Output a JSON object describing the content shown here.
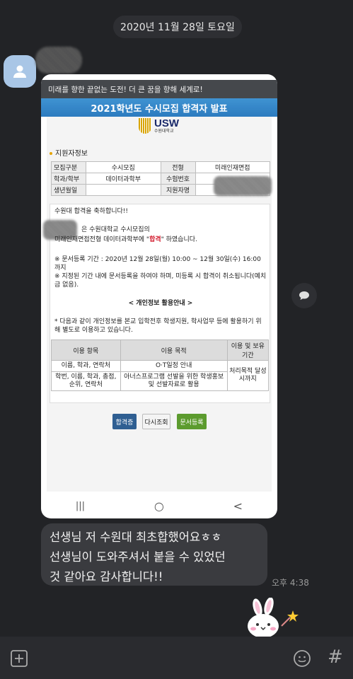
{
  "date_divider": "2020년 11월 28일 토요일",
  "colors": {
    "background": "#222326",
    "bubble": "#3a3b3f",
    "avatar": "#a9c6e6",
    "title_bar": "#2c7bbf",
    "accent_red": "#d2192b"
  },
  "icons": {
    "avatar": "person-icon",
    "share": "speech-bubble-icon",
    "add": "plus-icon",
    "emoji": "emoji-icon",
    "hash": "hashtag-icon"
  },
  "photo": {
    "banner": "미래를 향한 끝없는 도전! 더 큰 꿈을 향해 세계로!",
    "title": "2021학년도 수시모집 합격자 발표",
    "logo_main": "USW",
    "logo_sub": "수원대학교",
    "section_title": "지원자정보",
    "info": {
      "r1c1": "모집구분",
      "r1c2": "수시모집",
      "r1c3": "전형",
      "r1c4": "미래인재면접",
      "r2c1": "학과/학부",
      "r2c2": "데이터과학부",
      "r2c3": "수험번호",
      "r3c1": "생년월일",
      "r3c3": "지원자명"
    },
    "message": {
      "congrats": "수원대 합격을 축하합니다!!",
      "line1": "은 수원대학교 수시모집의",
      "line2_pre": "미래인재면접전형 데이터과학부에 \"",
      "line2_hl": "합격",
      "line2_post": "\" 하였습니다.",
      "notice1": "※ 문서등록 기간 : 2020년 12월 28일(월) 10:00 ~ 12월 30일(수) 16:00까지",
      "notice2": "※ 지정된 기간 내에 문서등록을 하여야 하며, 미등록 시 합격이 취소됩니다(예치금 없음).",
      "privacy_title": "< 개인정보 활용안내 >",
      "privacy_text": "* 다음과 같이 개인정보를 본교 입학전후 학생지원, 학사업무 등에 활용하기 위해 별도로 이용하고 있습니다."
    },
    "use_table": {
      "headers": [
        "이용 항목",
        "이용 목적",
        "이용 및 보유기간"
      ],
      "r1c1": "이름, 학과, 연락처",
      "r1c2": "O·T일정 안내",
      "r2c1": "학번, 이름, 학과, 총점, 순위, 연락처",
      "r2c2": "아너스프로그램 선발을 위한 학생홍보 및 선발자료로 활용",
      "retention": "처리목적 달성시까지"
    },
    "buttons": {
      "pass_cert": "합격증",
      "retry": "다시조회",
      "register": "문서등록"
    },
    "nav": {
      "recents": "|||",
      "home": "○",
      "back": "<"
    }
  },
  "message": {
    "text_line1": "선생님 저 수원대 최초합했어요ㅎㅎ",
    "text_line2": "선생님이 도와주셔서 붙을 수 있었던",
    "text_line3": "것 같아요 감사합니다!!",
    "time": "오후 4:38"
  },
  "input": {
    "hash_label": "#"
  }
}
